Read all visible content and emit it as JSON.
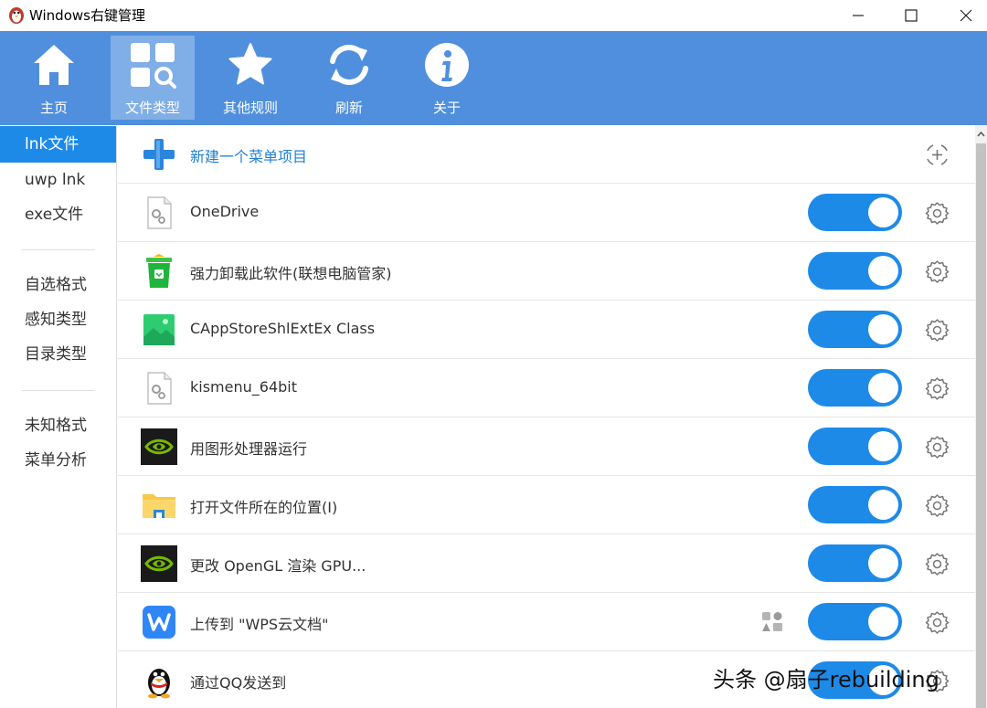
{
  "window": {
    "title": "Windows右键管理",
    "minimize_icon": "minimize-icon",
    "maximize_icon": "maximize-icon",
    "close_icon": "close-icon"
  },
  "toolbar": {
    "buttons": [
      {
        "label": "主页",
        "icon": "home-icon",
        "active": false
      },
      {
        "label": "文件类型",
        "icon": "file-type-search-icon",
        "active": true
      },
      {
        "label": "其他规则",
        "icon": "star-icon",
        "active": false
      },
      {
        "label": "刷新",
        "icon": "refresh-icon",
        "active": false
      },
      {
        "label": "关于",
        "icon": "info-icon",
        "active": false
      }
    ]
  },
  "sidebar": {
    "items": [
      {
        "label": "lnk文件",
        "active": true
      },
      {
        "label": "uwp lnk",
        "active": false
      },
      {
        "label": "exe文件",
        "active": false
      },
      {
        "label": "自选格式",
        "active": false
      },
      {
        "label": "感知类型",
        "active": false
      },
      {
        "label": "目录类型",
        "active": false
      },
      {
        "label": "未知格式",
        "active": false
      },
      {
        "label": "菜单分析",
        "active": false
      }
    ]
  },
  "main": {
    "new_item": {
      "label": "新建一个菜单项目",
      "icon": "add-plus-icon",
      "action_icon": "add-circle-icon"
    },
    "rows": [
      {
        "label": "OneDrive",
        "icon": "generic-settings-file-icon",
        "enabled": true
      },
      {
        "label": "强力卸载此软件(联想电脑管家)",
        "icon": "green-trash-can-icon",
        "enabled": true
      },
      {
        "label": "CAppStoreShlExtEx Class",
        "icon": "green-picture-icon",
        "enabled": true
      },
      {
        "label": "kismenu_64bit",
        "icon": "generic-settings-file-icon",
        "enabled": true
      },
      {
        "label": "用图形处理器运行",
        "icon": "nvidia-icon",
        "enabled": true
      },
      {
        "label": "打开文件所在的位置(I)",
        "icon": "folder-icon",
        "enabled": true
      },
      {
        "label": "更改 OpenGL 渲染 GPU...",
        "icon": "nvidia-icon",
        "enabled": true
      },
      {
        "label": "上传到 \"WPS云文档\"",
        "icon": "wps-icon",
        "enabled": true,
        "extra_icon": "shapes-icon"
      },
      {
        "label": "通过QQ发送到",
        "icon": "qq-penguin-icon",
        "enabled": true
      }
    ]
  },
  "watermark": "头条 @扇子rebuilding",
  "colors": {
    "accent": "#1e8ae8",
    "toolbar": "#4f8fdd"
  }
}
